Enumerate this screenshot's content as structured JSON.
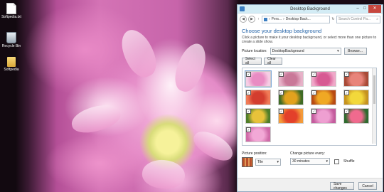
{
  "desktop": {
    "icons": [
      {
        "label": "Softpedia.txt",
        "icon": "text-file-icon"
      },
      {
        "label": "Recycle Bin",
        "icon": "recycle-bin-icon"
      },
      {
        "label": "Softpedia",
        "icon": "folder-icon"
      }
    ]
  },
  "window": {
    "title": "Desktop Background",
    "controls": {
      "minimize": "–",
      "maximize": "□",
      "close": "✕"
    },
    "address": {
      "seg1": "Pers...",
      "seg2": "Desktop Back...",
      "sep": "›"
    },
    "search_placeholder": "Search Control Pa...",
    "heading": "Choose your desktop background",
    "description": "Click a picture to make it your desktop background, or select more than one picture to create a slide show.",
    "picture_location_label": "Picture location:",
    "picture_location_value": "DesktopBackground",
    "browse_label": "Browse...",
    "select_all_label": "Select all",
    "clear_all_label": "Clear all",
    "thumbnails": [
      {
        "color_a": "#e98cc3",
        "color_b": "#f6cde4",
        "checked": true
      },
      {
        "color_a": "#c97898",
        "color_b": "#e7b2c8",
        "checked": true
      },
      {
        "color_a": "#d75a93",
        "color_b": "#f0a8c9",
        "checked": true
      },
      {
        "color_a": "#e8847a",
        "color_b": "#a84a36",
        "checked": true
      },
      {
        "color_a": "#d33d2e",
        "color_b": "#f07a56",
        "checked": true
      },
      {
        "color_a": "#e2a21e",
        "color_b": "#3f6b25",
        "checked": true
      },
      {
        "color_a": "#f0a824",
        "color_b": "#b84a12",
        "checked": true
      },
      {
        "color_a": "#f2d83b",
        "color_b": "#c69320",
        "checked": true
      },
      {
        "color_a": "#e8c23a",
        "color_b": "#4e7d2a",
        "checked": true
      },
      {
        "color_a": "#e3402a",
        "color_b": "#f39b3a",
        "checked": true
      },
      {
        "color_a": "#ee9fd1",
        "color_b": "#c45c9d",
        "checked": true
      },
      {
        "color_a": "#f06a8e",
        "color_b": "#2e6b2e",
        "checked": true
      },
      {
        "color_a": "#f2a8d6",
        "color_b": "#d06aa8",
        "checked": true
      }
    ],
    "picture_position_label": "Picture position:",
    "picture_position_value": "Tile",
    "change_every_label": "Change picture every:",
    "change_every_value": "30 minutes",
    "shuffle_label": "Shuffle",
    "save_label": "Save changes",
    "cancel_label": "Cancel"
  },
  "colors": {
    "heading": "#1e5fa5",
    "titlebar": "#d3ecf5",
    "close": "#c7473f"
  }
}
